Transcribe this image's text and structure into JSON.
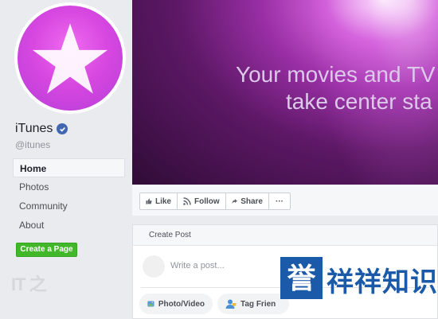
{
  "page": {
    "name": "iTunes",
    "handle": "@itunes"
  },
  "nav": {
    "items": [
      "Home",
      "Photos",
      "Community",
      "About"
    ],
    "active_index": 0
  },
  "create_page_button": "Create a Page",
  "cover": {
    "line1": "Your movies and TV",
    "line2": "take center sta"
  },
  "actions": {
    "like": "Like",
    "follow": "Follow",
    "share": "Share",
    "more": "···"
  },
  "post": {
    "header": "Create Post",
    "placeholder": "Write a post...",
    "photo_video": "Photo/Video",
    "tag_friends": "Tag Frien"
  },
  "watermark": {
    "box_char": "誉",
    "text": "祥祥知识",
    "logo_it": "IT",
    "logo_char": "之"
  },
  "colors": {
    "accent": "#4267b2",
    "green": "#42b72a",
    "itunes_pink": "#d748e0",
    "watermark_blue": "#1a5aa8"
  },
  "icons": [
    "star-icon",
    "verified-check-icon",
    "thumbs-up-icon",
    "rss-follow-icon",
    "share-arrow-icon",
    "more-dots-icon",
    "photo-icon",
    "tag-friends-icon"
  ]
}
